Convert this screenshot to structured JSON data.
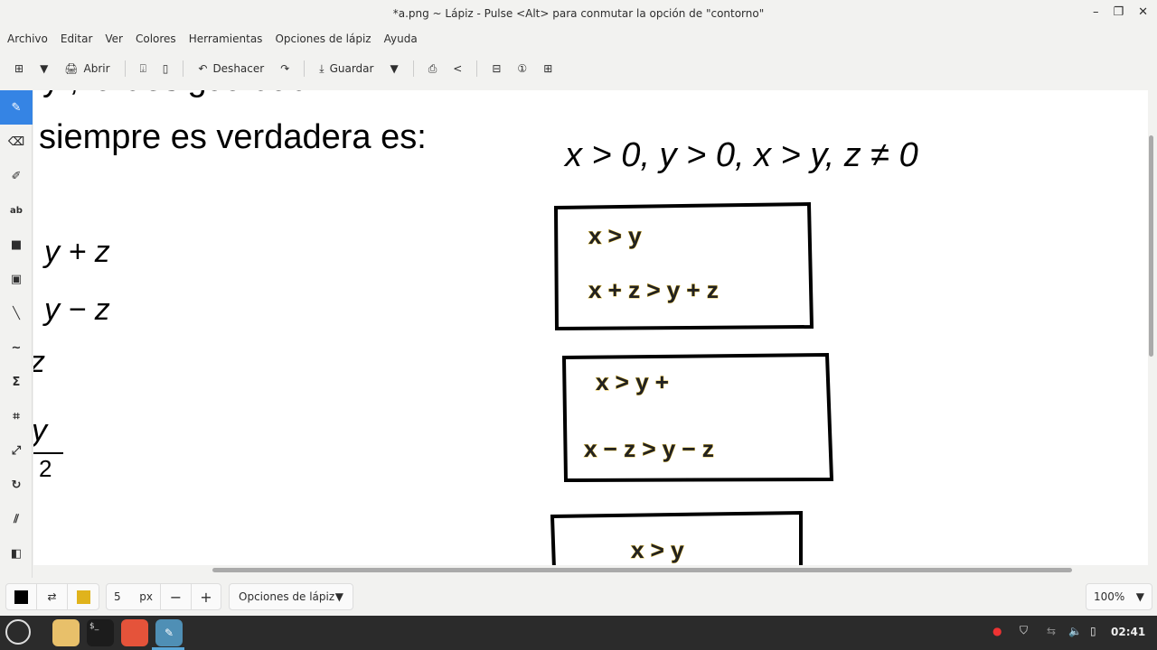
{
  "window": {
    "title": "*a.png ~ Lápiz - Pulse <Alt> para conmutar la opción de \"contorno\""
  },
  "menu": [
    "Archivo",
    "Editar",
    "Ver",
    "Colores",
    "Herramientas",
    "Opciones de lápiz",
    "Ayuda"
  ],
  "toolbar": {
    "open": "Abrir",
    "undo": "Deshacer",
    "save": "Guardar"
  },
  "canvas": {
    "line0": "y , la desigualdad",
    "line1": "siempre es verdadera es:",
    "condition": "x > 0, y > 0,  x > y,  z ≠ 0",
    "left": [
      "y + z",
      "y − z",
      "z",
      "y",
      "2"
    ],
    "box1": [
      "x  > y",
      "x + z  >  y + z"
    ],
    "box2": [
      "x  > y +",
      "x   − z   >    y  − z"
    ],
    "box3": [
      "x  > y"
    ]
  },
  "bottom": {
    "size": "5",
    "unit": "px",
    "options": "Opciones de lápiz",
    "zoom": "100%",
    "primary_color": "#000000",
    "secondary_color": "#e0b31c"
  },
  "taskbar": {
    "clock": "02:41"
  }
}
